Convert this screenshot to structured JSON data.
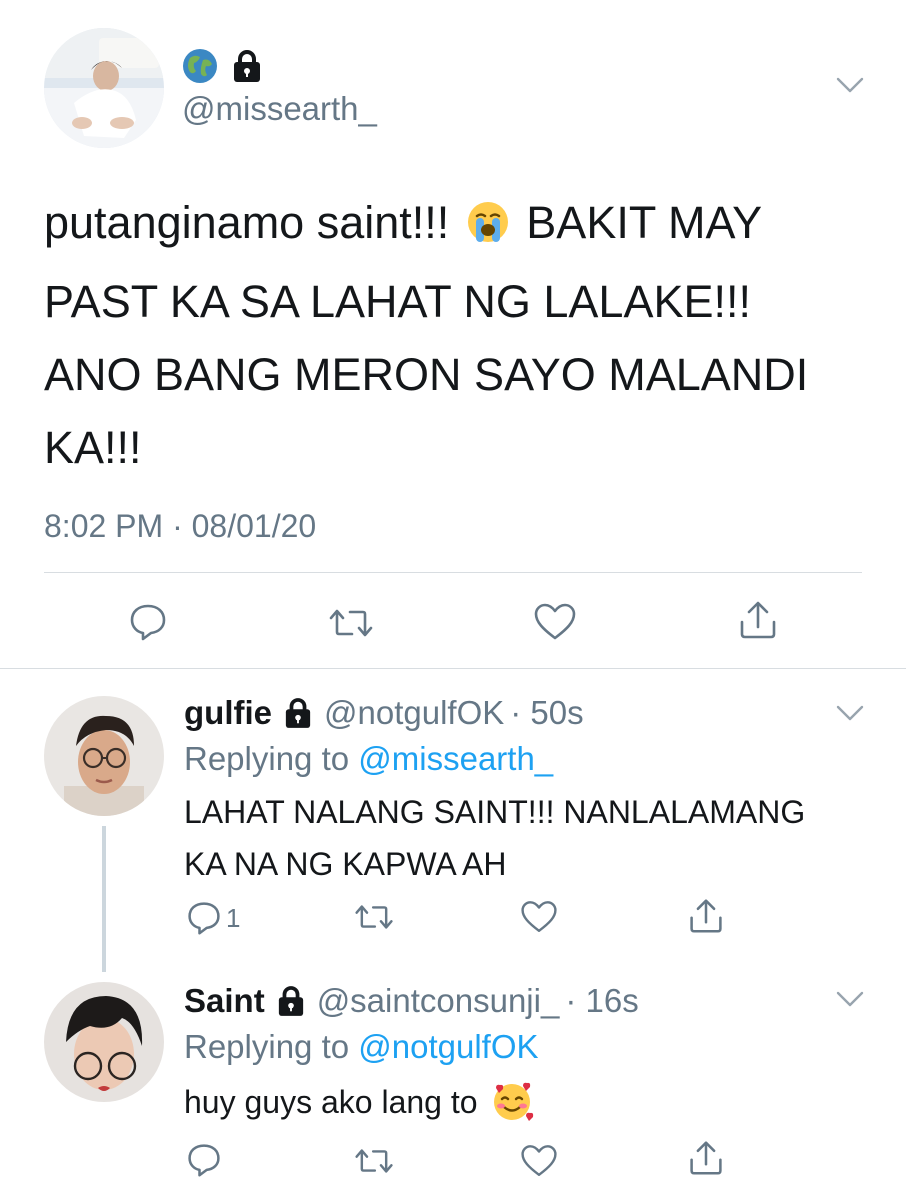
{
  "main_tweet": {
    "handle": "@missearth_",
    "text_lines": [
      {
        "before": "putanginamo saint!!!",
        "emoji": "crying-face-icon",
        "after": "BAKIT MAY"
      },
      {
        "text": "PAST KA SA LAHAT NG LALAKE!!!"
      },
      {
        "text": "ANO BANG MERON SAYO MALANDI"
      },
      {
        "text": "KA!!!"
      }
    ],
    "timestamp": "8:02 PM · 08/01/20",
    "name_icons": [
      "globe-icon",
      "lock-icon"
    ]
  },
  "replies": [
    {
      "name": "gulfie",
      "handle": "@notgulfOK",
      "time": "· 50s",
      "replying_prefix": "Replying to ",
      "replying_to": "@missearth_",
      "text_lines": [
        "LAHAT NALANG SAINT!!! NANLALAMANG",
        "KA NA NG KAPWA AH"
      ],
      "reply_count": "1"
    },
    {
      "name": "Saint",
      "handle": "@saintconsunji_",
      "time": "· 16s",
      "replying_prefix": "Replying to ",
      "replying_to": "@notgulfOK",
      "text": "huy guys ako lang to",
      "emoji": "smiling-face-with-hearts-icon"
    }
  ],
  "colors": {
    "text": "#14171a",
    "secondary": "#657786",
    "link": "#1da1f2",
    "divider": "#d8dde1",
    "thread_line": "#ccd6dd"
  }
}
